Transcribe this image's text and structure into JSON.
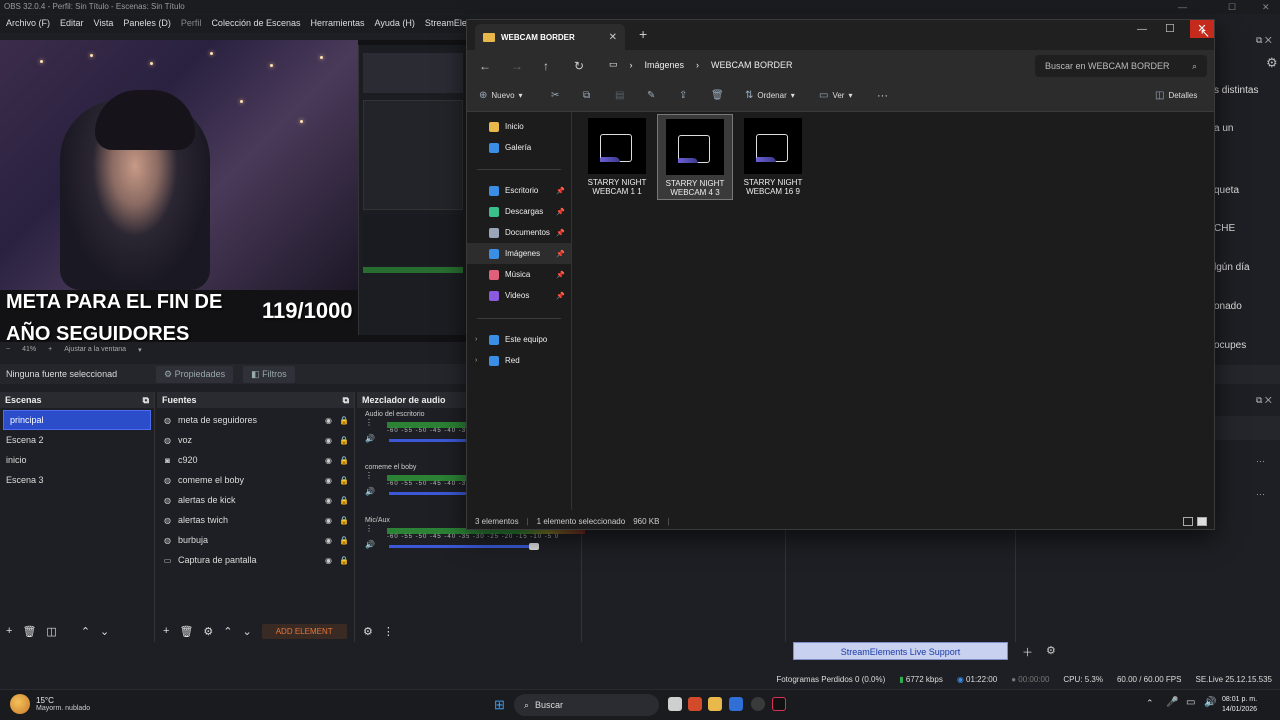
{
  "obs": {
    "title": "OBS 32.0.4 - Perfil: Sin Título - Escenas: Sin Título",
    "menu": [
      "Archivo (F)",
      "Editar",
      "Vista",
      "Paneles (D)",
      "Perfil",
      "Colección de Escenas",
      "Herramientas",
      "Ayuda (H)",
      "StreamEleme"
    ],
    "goal_text": "META PARA EL FIN DE AÑO SEGUIDORES",
    "goal_count": "119/1000",
    "zoom": "41%",
    "zoom_mode": "Ajustar a la ventana",
    "no_source": "Ninguna fuente seleccionad",
    "properties_btn": "Propiedades",
    "filters_btn": "Filtros",
    "scenes": {
      "title": "Escenas",
      "items": [
        "principal",
        "Escena 2",
        "inicio",
        "Escena 3"
      ],
      "selected": "principal"
    },
    "sources": {
      "title": "Fuentes",
      "items": [
        {
          "name": "meta de seguidores",
          "icon": "globe-icon"
        },
        {
          "name": "voz",
          "icon": "globe-icon"
        },
        {
          "name": "c920",
          "icon": "camera-icon"
        },
        {
          "name": "comeme el boby",
          "icon": "globe-icon"
        },
        {
          "name": "alertas de kick",
          "icon": "globe-icon"
        },
        {
          "name": "alertas twich",
          "icon": "globe-icon"
        },
        {
          "name": "burbuja",
          "icon": "globe-icon"
        },
        {
          "name": "Captura de pantalla",
          "icon": "monitor-icon"
        }
      ],
      "add_element": "ADD ELEMENT"
    },
    "mixer": {
      "title": "Mezclador de audio",
      "scale": "-60 -55 -50 -45 -40 -35 -30 -25 -20 -15 -10 -5 0",
      "channels": [
        {
          "name": "Audio del escritorio",
          "level": 0.55
        },
        {
          "name": "comeme el boby",
          "level": 0.55
        },
        {
          "name": "Mic/Aux",
          "level": 0.72
        }
      ]
    },
    "right_chat": [
      "s distintas",
      "a un",
      "queta",
      "CHE",
      "lgún día",
      "onado",
      "ocupes"
    ],
    "se_support": "StreamElements Live Support",
    "status": {
      "dropped": "Fotogramas Perdidos 0 (0.0%)",
      "bitrate": "6772 kbps",
      "live_time": "01:22:00",
      "rec_time": "00:00:00",
      "cpu": "CPU: 5.3%",
      "fps": "60.00 / 60.00 FPS",
      "version": "SE.Live 25.12.15.535"
    }
  },
  "explorer": {
    "tab_title": "WEBCAM BORDER",
    "breadcrumb": [
      "Imágenes",
      "WEBCAM BORDER"
    ],
    "search_placeholder": "Buscar en WEBCAM BORDER",
    "commands": {
      "new": "Nuevo",
      "sort": "Ordenar",
      "view": "Ver",
      "details": "Detalles"
    },
    "nav": [
      {
        "label": "Inicio",
        "icon": "home-icon",
        "color": "#e9b84a"
      },
      {
        "label": "Galería",
        "icon": "gallery-icon",
        "color": "#3a8ee6"
      },
      {
        "label": "Escritorio",
        "icon": "desktop-icon",
        "color": "#3a8ee6",
        "pinned": true
      },
      {
        "label": "Descargas",
        "icon": "download-icon",
        "color": "#3ac08a",
        "pinned": true
      },
      {
        "label": "Documentos",
        "icon": "documents-icon",
        "color": "#9aa6b8",
        "pinned": true
      },
      {
        "label": "Imágenes",
        "icon": "pictures-icon",
        "color": "#3a8ee6",
        "pinned": true
      },
      {
        "label": "Música",
        "icon": "music-icon",
        "color": "#e0607a",
        "pinned": true
      },
      {
        "label": "Videos",
        "icon": "videos-icon",
        "color": "#8a5ae0",
        "pinned": true
      },
      {
        "label": "Este equipo",
        "icon": "pc-icon",
        "color": "#3a8ee6"
      },
      {
        "label": "Red",
        "icon": "network-icon",
        "color": "#3a8ee6"
      }
    ],
    "files": [
      {
        "line1": "STARRY NIGHT",
        "line2": "WEBCAM 1 1",
        "selected": false
      },
      {
        "line1": "STARRY NIGHT",
        "line2": "WEBCAM 4 3",
        "selected": true
      },
      {
        "line1": "STARRY NIGHT",
        "line2": "WEBCAM 16 9",
        "selected": false
      }
    ],
    "status": {
      "count": "3 elementos",
      "selection": "1 elemento seleccionado",
      "size": "960 KB"
    }
  },
  "taskbar": {
    "temp": "15°C",
    "weather": "Mayorm. nublado",
    "search": "Buscar",
    "time": "08:01 p. m.",
    "date": "14/01/2026"
  }
}
